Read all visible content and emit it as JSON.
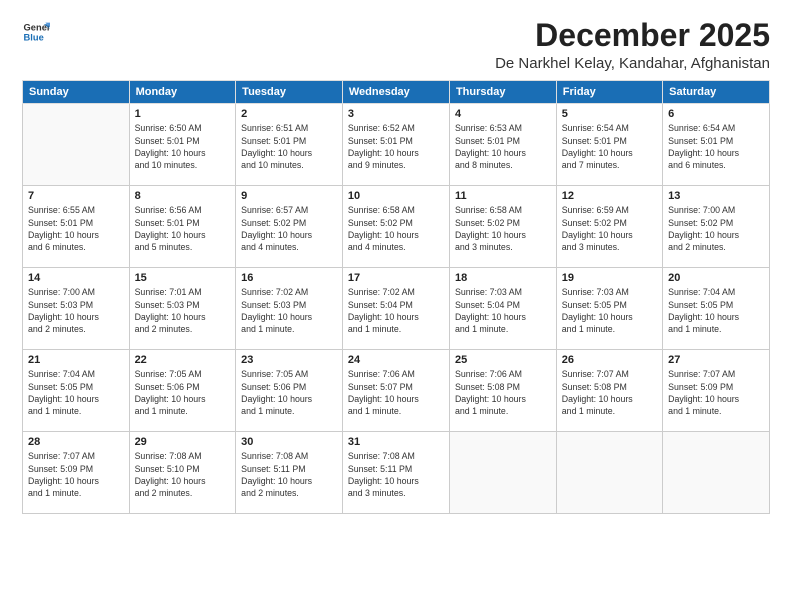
{
  "logo": {
    "line1": "General",
    "line2": "Blue"
  },
  "title": "December 2025",
  "location": "De Narkhel Kelay, Kandahar, Afghanistan",
  "weekdays": [
    "Sunday",
    "Monday",
    "Tuesday",
    "Wednesday",
    "Thursday",
    "Friday",
    "Saturday"
  ],
  "weeks": [
    [
      {
        "day": "",
        "info": ""
      },
      {
        "day": "1",
        "info": "Sunrise: 6:50 AM\nSunset: 5:01 PM\nDaylight: 10 hours\nand 10 minutes."
      },
      {
        "day": "2",
        "info": "Sunrise: 6:51 AM\nSunset: 5:01 PM\nDaylight: 10 hours\nand 10 minutes."
      },
      {
        "day": "3",
        "info": "Sunrise: 6:52 AM\nSunset: 5:01 PM\nDaylight: 10 hours\nand 9 minutes."
      },
      {
        "day": "4",
        "info": "Sunrise: 6:53 AM\nSunset: 5:01 PM\nDaylight: 10 hours\nand 8 minutes."
      },
      {
        "day": "5",
        "info": "Sunrise: 6:54 AM\nSunset: 5:01 PM\nDaylight: 10 hours\nand 7 minutes."
      },
      {
        "day": "6",
        "info": "Sunrise: 6:54 AM\nSunset: 5:01 PM\nDaylight: 10 hours\nand 6 minutes."
      }
    ],
    [
      {
        "day": "7",
        "info": "Sunrise: 6:55 AM\nSunset: 5:01 PM\nDaylight: 10 hours\nand 6 minutes."
      },
      {
        "day": "8",
        "info": "Sunrise: 6:56 AM\nSunset: 5:01 PM\nDaylight: 10 hours\nand 5 minutes."
      },
      {
        "day": "9",
        "info": "Sunrise: 6:57 AM\nSunset: 5:02 PM\nDaylight: 10 hours\nand 4 minutes."
      },
      {
        "day": "10",
        "info": "Sunrise: 6:58 AM\nSunset: 5:02 PM\nDaylight: 10 hours\nand 4 minutes."
      },
      {
        "day": "11",
        "info": "Sunrise: 6:58 AM\nSunset: 5:02 PM\nDaylight: 10 hours\nand 3 minutes."
      },
      {
        "day": "12",
        "info": "Sunrise: 6:59 AM\nSunset: 5:02 PM\nDaylight: 10 hours\nand 3 minutes."
      },
      {
        "day": "13",
        "info": "Sunrise: 7:00 AM\nSunset: 5:02 PM\nDaylight: 10 hours\nand 2 minutes."
      }
    ],
    [
      {
        "day": "14",
        "info": "Sunrise: 7:00 AM\nSunset: 5:03 PM\nDaylight: 10 hours\nand 2 minutes."
      },
      {
        "day": "15",
        "info": "Sunrise: 7:01 AM\nSunset: 5:03 PM\nDaylight: 10 hours\nand 2 minutes."
      },
      {
        "day": "16",
        "info": "Sunrise: 7:02 AM\nSunset: 5:03 PM\nDaylight: 10 hours\nand 1 minute."
      },
      {
        "day": "17",
        "info": "Sunrise: 7:02 AM\nSunset: 5:04 PM\nDaylight: 10 hours\nand 1 minute."
      },
      {
        "day": "18",
        "info": "Sunrise: 7:03 AM\nSunset: 5:04 PM\nDaylight: 10 hours\nand 1 minute."
      },
      {
        "day": "19",
        "info": "Sunrise: 7:03 AM\nSunset: 5:05 PM\nDaylight: 10 hours\nand 1 minute."
      },
      {
        "day": "20",
        "info": "Sunrise: 7:04 AM\nSunset: 5:05 PM\nDaylight: 10 hours\nand 1 minute."
      }
    ],
    [
      {
        "day": "21",
        "info": "Sunrise: 7:04 AM\nSunset: 5:05 PM\nDaylight: 10 hours\nand 1 minute."
      },
      {
        "day": "22",
        "info": "Sunrise: 7:05 AM\nSunset: 5:06 PM\nDaylight: 10 hours\nand 1 minute."
      },
      {
        "day": "23",
        "info": "Sunrise: 7:05 AM\nSunset: 5:06 PM\nDaylight: 10 hours\nand 1 minute."
      },
      {
        "day": "24",
        "info": "Sunrise: 7:06 AM\nSunset: 5:07 PM\nDaylight: 10 hours\nand 1 minute."
      },
      {
        "day": "25",
        "info": "Sunrise: 7:06 AM\nSunset: 5:08 PM\nDaylight: 10 hours\nand 1 minute."
      },
      {
        "day": "26",
        "info": "Sunrise: 7:07 AM\nSunset: 5:08 PM\nDaylight: 10 hours\nand 1 minute."
      },
      {
        "day": "27",
        "info": "Sunrise: 7:07 AM\nSunset: 5:09 PM\nDaylight: 10 hours\nand 1 minute."
      }
    ],
    [
      {
        "day": "28",
        "info": "Sunrise: 7:07 AM\nSunset: 5:09 PM\nDaylight: 10 hours\nand 1 minute."
      },
      {
        "day": "29",
        "info": "Sunrise: 7:08 AM\nSunset: 5:10 PM\nDaylight: 10 hours\nand 2 minutes."
      },
      {
        "day": "30",
        "info": "Sunrise: 7:08 AM\nSunset: 5:11 PM\nDaylight: 10 hours\nand 2 minutes."
      },
      {
        "day": "31",
        "info": "Sunrise: 7:08 AM\nSunset: 5:11 PM\nDaylight: 10 hours\nand 3 minutes."
      },
      {
        "day": "",
        "info": ""
      },
      {
        "day": "",
        "info": ""
      },
      {
        "day": "",
        "info": ""
      }
    ]
  ]
}
